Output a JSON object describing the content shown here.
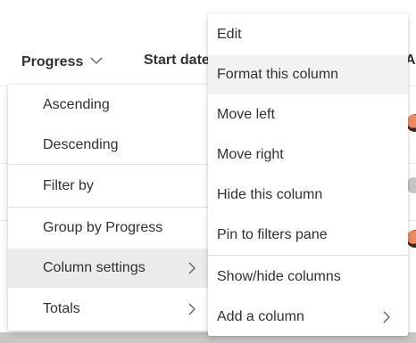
{
  "table": {
    "columns": [
      {
        "label": "Progress"
      },
      {
        "label": "Start date"
      },
      {
        "label": "Assi"
      }
    ]
  },
  "column_menu": {
    "items": [
      {
        "label": "Ascending"
      },
      {
        "label": "Descending"
      },
      {
        "label": "Filter by"
      },
      {
        "label": "Group by Progress"
      },
      {
        "label": "Column settings",
        "selected": true
      },
      {
        "label": "Totals"
      }
    ]
  },
  "column_settings_menu": {
    "items": [
      {
        "label": "Edit"
      },
      {
        "label": "Format this column",
        "hovered": true
      },
      {
        "label": "Move left"
      },
      {
        "label": "Move right"
      },
      {
        "label": "Hide this column"
      },
      {
        "label": "Pin to filters pane"
      },
      {
        "label": "Show/hide columns"
      },
      {
        "label": "Add a column"
      }
    ]
  },
  "icons": {
    "header_chevron": "chevron-down-icon",
    "submenu_arrow": "chevron-right-icon"
  },
  "colors": {
    "text": "#323130",
    "selected_bg": "#edebe9",
    "hover_bg": "#f3f2f1",
    "divider": "#e1dfdd"
  }
}
